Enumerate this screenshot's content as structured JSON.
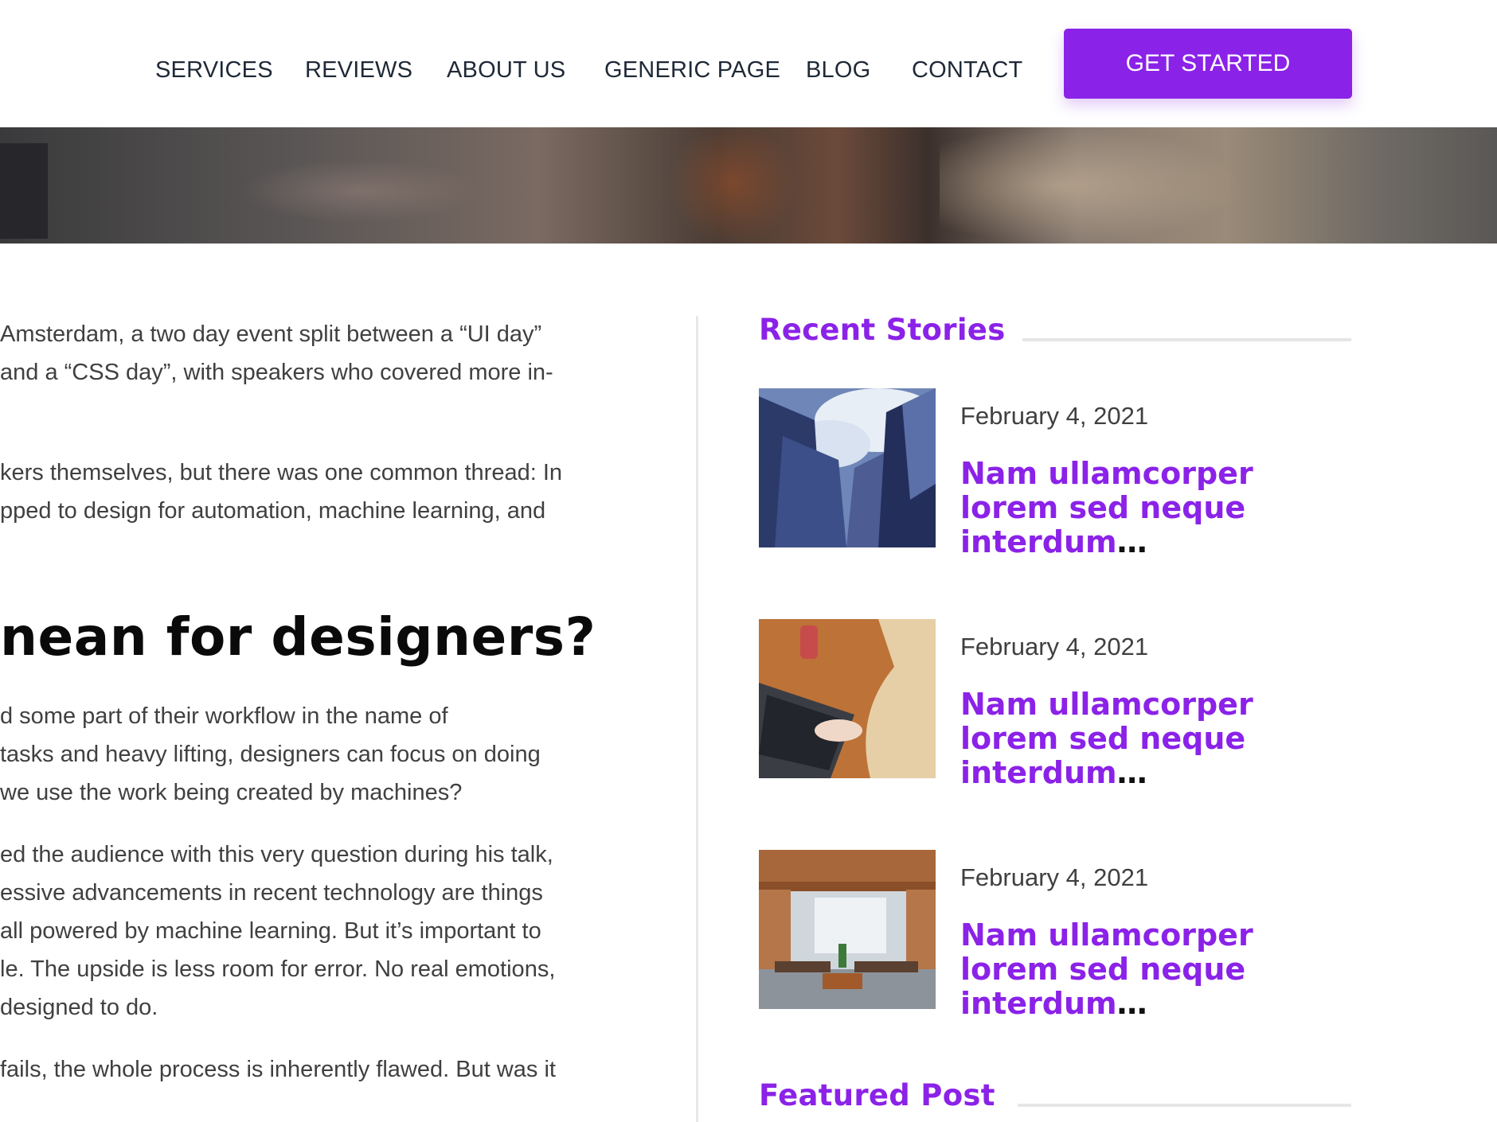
{
  "nav": {
    "links": [
      "SERVICES",
      "REVIEWS",
      "ABOUT US",
      "GENERIC PAGE",
      "BLOG",
      "CONTACT"
    ],
    "cta_label": "GET STARTED"
  },
  "article": {
    "p1": [
      "Amsterdam, a two day event split between a “UI day”",
      "and a “CSS day”, with speakers who covered more in-"
    ],
    "p2": [
      "kers themselves, but there was one common thread: In",
      "pped to design for automation, machine learning, and"
    ],
    "heading": "nean for designers?",
    "p3": [
      "d some part of their workflow in the name of",
      " tasks and heavy lifting, designers can focus on doing",
      " we use the work being created by machines?"
    ],
    "p4": [
      "ed the audience with this very question during his talk,",
      "essive advancements in recent technology are things",
      "all powered by machine learning. But it’s important to",
      "le. The upside is less room for error. No real emotions,",
      "designed to do."
    ],
    "p5": [
      "fails, the whole process is inherently flawed. But was it"
    ]
  },
  "sidebar": {
    "recent_title": "Recent Stories",
    "featured_title": "Featured Post",
    "stories": [
      {
        "date": "February 4, 2021",
        "title": "Nam ullamcorper lorem sed neque interdum",
        "ellipsis": "…",
        "thumb": "glass-skyscrapers-image"
      },
      {
        "date": "February 4, 2021",
        "title": "Nam ullamcorper lorem sed neque interdum",
        "ellipsis": "…",
        "thumb": "laptop-typing-image"
      },
      {
        "date": "February 4, 2021",
        "title": "Nam ullamcorper lorem sed neque interdum",
        "ellipsis": "…",
        "thumb": "open-office-image"
      }
    ]
  },
  "colors": {
    "accent": "#8b22e8",
    "text": "#404040",
    "heading": "#0a0a0a",
    "nav": "#1f2937"
  }
}
